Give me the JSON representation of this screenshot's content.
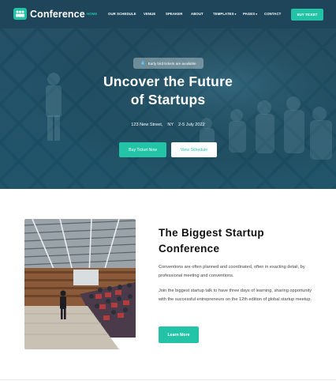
{
  "header": {
    "brand": "Conference",
    "nav": [
      {
        "label": "HOME",
        "active": true
      },
      {
        "label": "OUR SCHEDULE",
        "active": false
      },
      {
        "label": "VENUE",
        "active": false
      },
      {
        "label": "SPEAKER",
        "active": false
      },
      {
        "label": "ABOUT",
        "active": false
      },
      {
        "label": "TEMPLATES",
        "active": false,
        "dropdown": true
      },
      {
        "label": "PAGES",
        "active": false,
        "dropdown": true
      },
      {
        "label": "CONTACT",
        "active": false
      }
    ],
    "cta": "BUY TICKET"
  },
  "hero": {
    "badge": "Early bird tickets are available",
    "title_line1": "Uncover the Future",
    "title_line2": "of Startups",
    "address": "123 New Street,",
    "city": "NY",
    "dates": "2-5 July 2022",
    "primary_button": "Buy Ticket Now",
    "secondary_button": "View Schedule"
  },
  "about": {
    "title_line1": "The Biggest Startup",
    "title_line2": "Conference",
    "paragraph1": "Conventions are often planned and coordinated, often in exacting detail, by professional meeting and conventions.",
    "paragraph2": "Join the biggest startup talk to have three days of learning, sharing opportunity with the successful entrepreneurs on the 12th edition of global startup meetup.",
    "button": "Learn More"
  },
  "colors": {
    "accent": "#22c3a6",
    "header_bg": "#1e4559",
    "hero_bg": "#1b4d63"
  }
}
